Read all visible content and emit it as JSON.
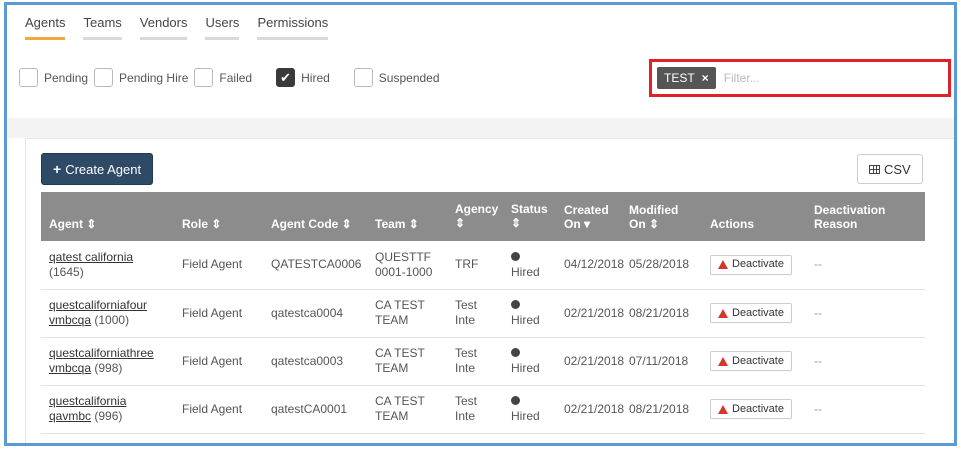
{
  "tabs": [
    {
      "label": "Agents",
      "active": true
    },
    {
      "label": "Teams",
      "active": false
    },
    {
      "label": "Vendors",
      "active": false
    },
    {
      "label": "Users",
      "active": false
    },
    {
      "label": "Permissions",
      "active": false
    }
  ],
  "status_filters": [
    {
      "label": "Pending",
      "checked": false
    },
    {
      "label": "Pending Hire",
      "checked": false
    },
    {
      "label": "Failed",
      "checked": false
    },
    {
      "label": "Hired",
      "checked": true
    },
    {
      "label": "Suspended",
      "checked": false
    }
  ],
  "filter": {
    "tag": "TEST",
    "tag_remove": "×",
    "placeholder": "Filter...",
    "value": ""
  },
  "toolbar": {
    "create_label": "Create Agent",
    "create_icon": "+",
    "csv_label": "CSV"
  },
  "table": {
    "headers": {
      "agent": "Agent ⇕",
      "role": "Role ⇕",
      "code": "Agent Code ⇕",
      "team": "Team ⇕",
      "agency_1": "Agency",
      "agency_2": "⇕",
      "status_1": "Status",
      "status_2": "⇕",
      "created_1": "Created",
      "created_2": "On ▾",
      "modified_1": "Modified",
      "modified_2": "On ⇕",
      "actions": "Actions",
      "reason_1": "Deactivation",
      "reason_2": "Reason"
    },
    "rows": [
      {
        "agent_1": "qatest california",
        "agent_2": "",
        "agent_id": "(1645)",
        "role": "Field Agent",
        "code": "QATESTCA0006",
        "team_1": "QUESTTF",
        "team_2": "0001-1000",
        "agency": "TRF",
        "status": "Hired",
        "created": "04/12/2018",
        "modified": "05/28/2018",
        "action": "Deactivate",
        "reason": "--"
      },
      {
        "agent_1": "questcaliforniafour",
        "agent_2": "vmbcqa",
        "agent_id": "(1000)",
        "role": "Field Agent",
        "code": "qatestca0004",
        "team_1": "CA TEST",
        "team_2": "TEAM",
        "agency": "Test Inte",
        "status": "Hired",
        "created": "02/21/2018",
        "modified": "08/21/2018",
        "action": "Deactivate",
        "reason": "--"
      },
      {
        "agent_1": "questcaliforniathree",
        "agent_2": "vmbcqa",
        "agent_id": "(998)",
        "role": "Field Agent",
        "code": "qatestca0003",
        "team_1": "CA TEST",
        "team_2": "TEAM",
        "agency": "Test Inte",
        "status": "Hired",
        "created": "02/21/2018",
        "modified": "07/11/2018",
        "action": "Deactivate",
        "reason": "--"
      },
      {
        "agent_1": "questcalifornia",
        "agent_2": "qavmbc",
        "agent_id": "(996)",
        "role": "Field Agent",
        "code": "qatestCA0001",
        "team_1": "CA TEST",
        "team_2": "TEAM",
        "agency": "Test Inte",
        "status": "Hired",
        "created": "02/21/2018",
        "modified": "08/21/2018",
        "action": "Deactivate",
        "reason": "--"
      }
    ]
  },
  "colors": {
    "accent_tab": "#f0a93b",
    "primary_button": "#2e4a66",
    "header_bg": "#8c8c8c",
    "highlight_border": "#e0202a",
    "frame_border": "#5b9bd5",
    "warning_icon": "#d8352a"
  }
}
